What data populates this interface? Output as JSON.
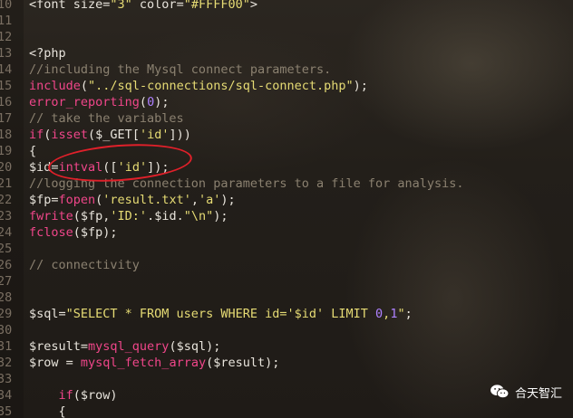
{
  "editor": {
    "lines": [
      {
        "num": "10",
        "text": "<font size=\"3\" color=\"#FFFF00\">"
      },
      {
        "num": "11",
        "text": ""
      },
      {
        "num": "12",
        "text": ""
      },
      {
        "num": "13",
        "text": "<?php"
      },
      {
        "num": "14",
        "text": "//including the Mysql connect parameters."
      },
      {
        "num": "15",
        "text": "include(\"../sql-connections/sql-connect.php\");"
      },
      {
        "num": "16",
        "text": "error_reporting(0);"
      },
      {
        "num": "17",
        "text": "// take the variables"
      },
      {
        "num": "18",
        "text": "if(isset($_GET['id']))"
      },
      {
        "num": "19",
        "text": "{"
      },
      {
        "num": "20",
        "text": "$id=intval(['id']);"
      },
      {
        "num": "21",
        "text": "//logging the connection parameters to a file for analysis."
      },
      {
        "num": "22",
        "text": "$fp=fopen('result.txt','a');"
      },
      {
        "num": "23",
        "text": "fwrite($fp,'ID:'.$id.\"\\n\");"
      },
      {
        "num": "24",
        "text": "fclose($fp);"
      },
      {
        "num": "25",
        "text": ""
      },
      {
        "num": "26",
        "text": "// connectivity"
      },
      {
        "num": "27",
        "text": ""
      },
      {
        "num": "28",
        "text": ""
      },
      {
        "num": "29",
        "text": "$sql=\"SELECT * FROM users WHERE id='$id' LIMIT 0,1\";"
      },
      {
        "num": "30",
        "text": ""
      },
      {
        "num": "31",
        "text": "$result=mysql_query($sql);"
      },
      {
        "num": "32",
        "text": "$row = mysql_fetch_array($result);"
      },
      {
        "num": "33",
        "text": ""
      },
      {
        "num": "34",
        "text": "    if($row)"
      },
      {
        "num": "35",
        "text": "    {"
      }
    ]
  },
  "watermark": {
    "label": "合天智汇",
    "icon": "wechat-icon"
  },
  "colors": {
    "keyword": "#f0468a",
    "string": "#e6db74",
    "comment": "#8b8170",
    "number": "#ae81ff",
    "highlight_ring": "#e0202a"
  }
}
